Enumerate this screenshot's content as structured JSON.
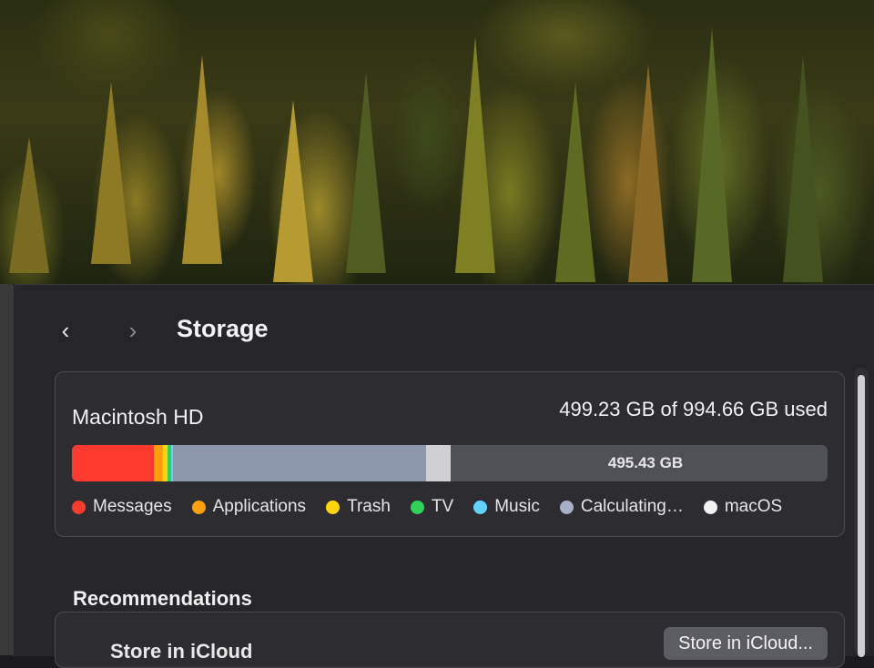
{
  "header": {
    "title": "Storage",
    "back_icon": "chevron-left",
    "forward_icon": "chevron-right"
  },
  "storage": {
    "volume_name": "Macintosh HD",
    "used_summary": "499.23 GB of 994.66 GB used",
    "free_label": "495.43 GB",
    "segments": [
      {
        "name": "Messages",
        "color": "#ff3b30",
        "fraction": 0.109
      },
      {
        "name": "Applications",
        "color": "#ff9f0a",
        "fraction": 0.012
      },
      {
        "name": "Trash",
        "color": "#ffd60a",
        "fraction": 0.006
      },
      {
        "name": "TV",
        "color": "#30d158",
        "fraction": 0.004
      },
      {
        "name": "Music",
        "color": "#64d2ff",
        "fraction": 0.003
      },
      {
        "name": "Calculating...",
        "color": "#8e98ad",
        "fraction": 0.335
      },
      {
        "name": "macOS",
        "color": "#d0d0d4",
        "fraction": 0.032
      }
    ],
    "legend": [
      {
        "label": "Messages",
        "color": "#ff3b30"
      },
      {
        "label": "Applications",
        "color": "#ff9f0a"
      },
      {
        "label": "Trash",
        "color": "#ffd60a"
      },
      {
        "label": "TV",
        "color": "#30d158"
      },
      {
        "label": "Music",
        "color": "#64d2ff"
      },
      {
        "label": "Calculating…",
        "color": "#a7b0c4"
      },
      {
        "label": "macOS",
        "color": "#f2f2f2"
      }
    ]
  },
  "recommendations": {
    "title": "Recommendations",
    "item_title": "Store in iCloud",
    "store_button": "Store in iCloud..."
  }
}
